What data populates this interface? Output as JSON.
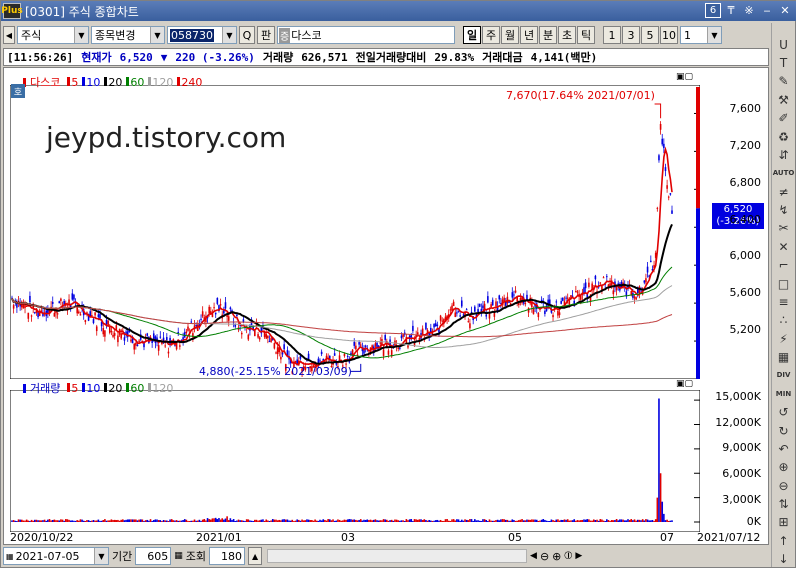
{
  "window": {
    "logo": "Plus",
    "title": "[0301] 주식 종합차트",
    "screen_no": "6",
    "ctrl_pin": "₸",
    "ctrl_pair": "※",
    "ctrl_min": "‒",
    "ctrl_close": "✕"
  },
  "toolbar": {
    "market_select": "주식",
    "change_select": "종목변경",
    "code_value": "058730",
    "search_icon": "Q",
    "pan_label": "판",
    "jeung_badge": "증",
    "stock_name": "다스코",
    "periods": [
      "일",
      "주",
      "월",
      "년",
      "분",
      "초",
      "틱"
    ],
    "active_period": "일",
    "intervals": [
      "1",
      "3",
      "5",
      "10"
    ],
    "interval_value": "1"
  },
  "infobar": {
    "time": "[11:56:26]",
    "price_label": "현재가",
    "price": "6,520",
    "arrow": "▼",
    "change": "220 (-3.26%)",
    "volume_label": "거래량",
    "volume": "626,571",
    "prevday_label": "전일거래량대비",
    "prevday": "29.83%",
    "amount_label": "거래대금",
    "amount": "4,141(백만)"
  },
  "price_legend": {
    "name": "다스코",
    "items": [
      {
        "label": "5",
        "color": "#e00000"
      },
      {
        "label": "10",
        "color": "#0000e0"
      },
      {
        "label": "20",
        "color": "#000000"
      },
      {
        "label": "60",
        "color": "#007f00"
      },
      {
        "label": "120",
        "color": "#a0a0a0"
      },
      {
        "label": "240",
        "color": "#e00000"
      }
    ]
  },
  "volume_legend": {
    "name": "거래량",
    "items": [
      {
        "label": "5",
        "color": "#e00000"
      },
      {
        "label": "10",
        "color": "#0000e0"
      },
      {
        "label": "20",
        "color": "#000000"
      },
      {
        "label": "60",
        "color": "#007f00"
      },
      {
        "label": "120",
        "color": "#a0a0a0"
      }
    ]
  },
  "ho_badge": "호",
  "watermark": "jeypd.tistory.com",
  "annotations": {
    "high": "7,670(17.64% 2021/07/01)",
    "low": "4,880(-25.15% 2021/03/09)"
  },
  "current_price_box": {
    "price": "6,520",
    "change": "(-3.26%)"
  },
  "price_axis": [
    "7,600",
    "7,200",
    "6,800",
    "6,400",
    "6,000",
    "5,600",
    "5,200"
  ],
  "volume_axis": [
    "15,000K",
    "12,000K",
    "9,000K",
    "6,000K",
    "3,000K",
    "0K"
  ],
  "x_axis": [
    "2020/10/22",
    "2021/01",
    "03",
    "05",
    "07",
    "2021/07/12"
  ],
  "bottom": {
    "date_value": "2021-07-05",
    "period_label": "기간",
    "period_value": "605",
    "lookup_label": "조회",
    "lookup_value": "180"
  },
  "sidebar_icons": [
    "U",
    "T",
    "✎",
    "⚒",
    "✐",
    "♻",
    "⇵",
    "AUTO",
    "≠",
    "↯",
    "✂",
    "✕",
    "⌐",
    "□",
    "≡",
    "∴",
    "⚡",
    "▦",
    "DIV",
    "MIN",
    "↺",
    "↻",
    "↶",
    "⊕",
    "⊖",
    "⇅",
    "⊞",
    "↑",
    "↓"
  ],
  "colors": {
    "up": "#e00000",
    "down": "#0000e0",
    "titlebar": "#3a5f9e"
  },
  "chart_data": {
    "type": "candlestick",
    "title": "",
    "series": [
      {
        "name": "다스코",
        "x": [
          "2020/10/22",
          "2020/11",
          "2020/12",
          "2021/01",
          "2021/02",
          "2021/03",
          "2021/04",
          "2021/05",
          "2021/06",
          "2021/07/01",
          "2021/07/12"
        ],
        "close": [
          5650,
          5500,
          5250,
          5350,
          5550,
          4950,
          5050,
          5400,
          5650,
          7600,
          6520
        ]
      }
    ],
    "ylim": [
      4800,
      7900
    ],
    "volume_ylim": [
      0,
      16000000
    ]
  }
}
